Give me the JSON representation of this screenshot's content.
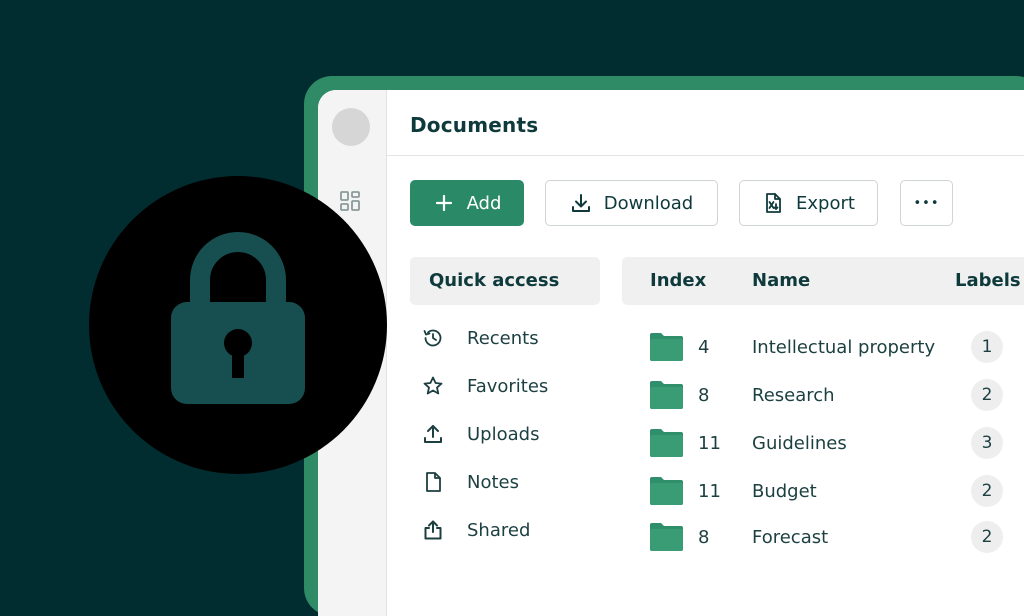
{
  "header": {
    "title": "Documents"
  },
  "toolbar": {
    "add_label": "Add",
    "download_label": "Download",
    "export_label": "Export",
    "more_label": "•••"
  },
  "quick_access": {
    "title": "Quick access",
    "items": [
      {
        "label": "Recents",
        "icon": "history-icon"
      },
      {
        "label": "Favorites",
        "icon": "star-icon"
      },
      {
        "label": "Uploads",
        "icon": "upload-icon"
      },
      {
        "label": "Notes",
        "icon": "file-icon"
      },
      {
        "label": "Shared",
        "icon": "share-icon"
      }
    ]
  },
  "table": {
    "columns": [
      "Index",
      "Name",
      "Labels"
    ],
    "rows": [
      {
        "index": "4",
        "name": "Intellectual property",
        "labels": "1"
      },
      {
        "index": "8",
        "name": "Research",
        "labels": "2"
      },
      {
        "index": "11",
        "name": "Guidelines",
        "labels": "3"
      },
      {
        "index": "11",
        "name": "Budget",
        "labels": "2"
      },
      {
        "index": "8",
        "name": "Forecast",
        "labels": "2"
      }
    ]
  },
  "colors": {
    "background": "#022d30",
    "accent": "#2a8a67",
    "frame": "#2f8a66",
    "text": "#0f3a3c",
    "lock_overlay": "#000000",
    "lock_icon": "#174f51"
  }
}
